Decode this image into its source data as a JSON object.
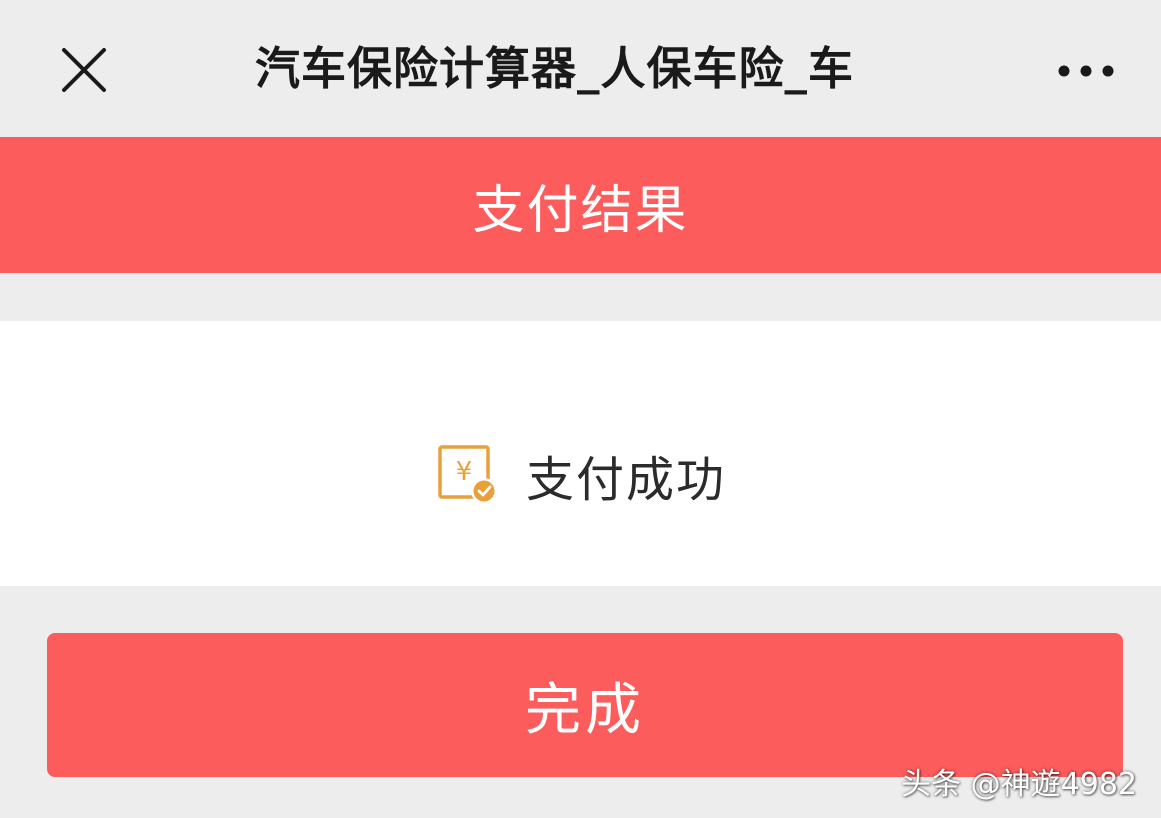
{
  "topbar": {
    "close_icon": "close-icon",
    "title": "汽车保险计算器_人保车险_车",
    "more_icon": "more-horizontal-icon"
  },
  "banner": {
    "title": "支付结果",
    "color": "#fd5c5c"
  },
  "result": {
    "icon": "payment-success-icon",
    "status_text": "支付成功",
    "icon_color": "#e8a13a"
  },
  "actions": {
    "done_label": "完成",
    "done_color": "#fd5c5c"
  },
  "watermark": {
    "text": "头条 @神遊4982"
  }
}
